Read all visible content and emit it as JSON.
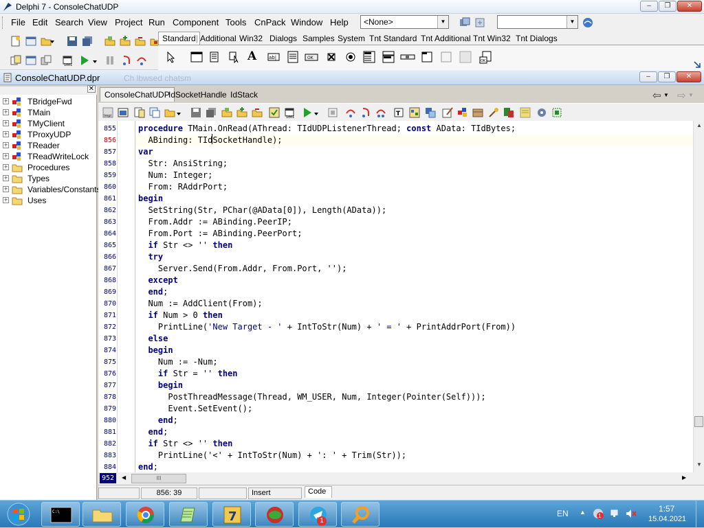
{
  "window": {
    "title": "Delphi 7 - ConsoleChatUDP",
    "minimize": "–",
    "restore": "❐",
    "close": "✕"
  },
  "menu": [
    "File",
    "Edit",
    "Search",
    "View",
    "Project",
    "Run",
    "Component",
    "Tools",
    "CnPack",
    "Window",
    "Help"
  ],
  "toolbar": {
    "config_combo": "<None>",
    "search_combo": ""
  },
  "palette_tabs": [
    "Standard",
    "Additional",
    "Win32",
    "Dialogs",
    "Samples",
    "System",
    "Tnt Standard",
    "Tnt Additional",
    "Tnt Win32",
    "Tnt Dialogs"
  ],
  "child": {
    "title": "ConsoleChatUDP.dpr",
    "background_caption": "Ch lbwsed chatsm"
  },
  "explorer": {
    "items": [
      "TBridgeFwd",
      "TMain",
      "TMyClient",
      "TProxyUDP",
      "TReader",
      "TReadWriteLock",
      "Procedures",
      "Types",
      "Variables/Constants",
      "Uses"
    ]
  },
  "editor": {
    "tabs": [
      "ConsoleChatUDP",
      "IdSocketHandle",
      "IdStack"
    ],
    "line_numbers": [
      "855",
      "856",
      "857",
      "858",
      "859",
      "860",
      "861",
      "862",
      "863",
      "864",
      "865",
      "866",
      "867",
      "868",
      "869",
      "870",
      "871",
      "872",
      "873",
      "874",
      "875",
      "876",
      "877",
      "878",
      "879",
      "880",
      "881",
      "882",
      "883",
      "884"
    ],
    "current_line_number": "952",
    "code_lines": [
      [
        [
          "kw",
          "procedure"
        ],
        [
          "t",
          " TMain.OnRead(AThread: TIdUDPListenerThread; "
        ],
        [
          "kw",
          "const"
        ],
        [
          "t",
          " AData: TIdBytes;"
        ]
      ],
      [
        [
          "t",
          "  ABinding: TIdSocketHandle);"
        ]
      ],
      [
        [
          "kw",
          "var"
        ]
      ],
      [
        [
          "t",
          "  Str: AnsiString;"
        ]
      ],
      [
        [
          "t",
          "  Num: Integer;"
        ]
      ],
      [
        [
          "t",
          "  From: RAddrPort;"
        ]
      ],
      [
        [
          "kw",
          "begin"
        ]
      ],
      [
        [
          "t",
          "  SetString(Str, PChar(@AData[0]), Length(AData));"
        ]
      ],
      [
        [
          "t",
          "  From.Addr := ABinding.PeerIP;"
        ]
      ],
      [
        [
          "t",
          "  From.Port := ABinding.PeerPort;"
        ]
      ],
      [
        [
          "t",
          "  "
        ],
        [
          "kw",
          "if"
        ],
        [
          "t",
          " Str <> '' "
        ],
        [
          "kw",
          "then"
        ]
      ],
      [
        [
          "t",
          "  "
        ],
        [
          "kw",
          "try"
        ]
      ],
      [
        [
          "t",
          "    Server.Send(From.Addr, From.Port, '');"
        ]
      ],
      [
        [
          "t",
          "  "
        ],
        [
          "kw",
          "except"
        ]
      ],
      [
        [
          "t",
          "  "
        ],
        [
          "kw",
          "end"
        ],
        [
          "t",
          ";"
        ]
      ],
      [
        [
          "t",
          "  Num := AddClient(From);"
        ]
      ],
      [
        [
          "t",
          "  "
        ],
        [
          "kw",
          "if"
        ],
        [
          "t",
          " Num > 0 "
        ],
        [
          "kw",
          "then"
        ]
      ],
      [
        [
          "t",
          "    PrintLine("
        ],
        [
          "str",
          "'New Target - '"
        ],
        [
          "t",
          " + IntToStr(Num) + "
        ],
        [
          "str",
          "' = '"
        ],
        [
          "t",
          " + PrintAddrPort(From))"
        ]
      ],
      [
        [
          "t",
          "  "
        ],
        [
          "kw",
          "else"
        ]
      ],
      [
        [
          "t",
          "  "
        ],
        [
          "kw",
          "begin"
        ]
      ],
      [
        [
          "t",
          "    Num := -Num;"
        ]
      ],
      [
        [
          "t",
          "    "
        ],
        [
          "kw",
          "if"
        ],
        [
          "t",
          " Str = '' "
        ],
        [
          "kw",
          "then"
        ]
      ],
      [
        [
          "t",
          "    "
        ],
        [
          "kw",
          "begin"
        ]
      ],
      [
        [
          "t",
          "      PostThreadMessage(Thread, WM_USER, Num, Integer(Pointer(Self)));"
        ]
      ],
      [
        [
          "t",
          "      Event.SetEvent();"
        ]
      ],
      [
        [
          "t",
          "    "
        ],
        [
          "kw",
          "end"
        ],
        [
          "t",
          ";"
        ]
      ],
      [
        [
          "t",
          "  "
        ],
        [
          "kw",
          "end"
        ],
        [
          "t",
          ";"
        ]
      ],
      [
        [
          "t",
          "  "
        ],
        [
          "kw",
          "if"
        ],
        [
          "t",
          " Str <> '' "
        ],
        [
          "kw",
          "then"
        ]
      ],
      [
        [
          "t",
          "    PrintLine('<' + IntToStr(Num) + ': ' + Trim(Str));"
        ]
      ],
      [
        [
          "kw",
          "end"
        ],
        [
          "t",
          ";"
        ]
      ]
    ],
    "hscroll_thumb": "III"
  },
  "status": {
    "position": "856:  39",
    "mode": "Insert",
    "view_tab": "Code"
  },
  "taskbar": {
    "language": "EN",
    "time": "1:57",
    "date": "15.04.2021",
    "notify_badge": "1",
    "telegram_badge": "1"
  },
  "colors": {
    "keyword": "#000080",
    "current_line_number": "#c00000",
    "taskbar": "#2a78b8"
  }
}
